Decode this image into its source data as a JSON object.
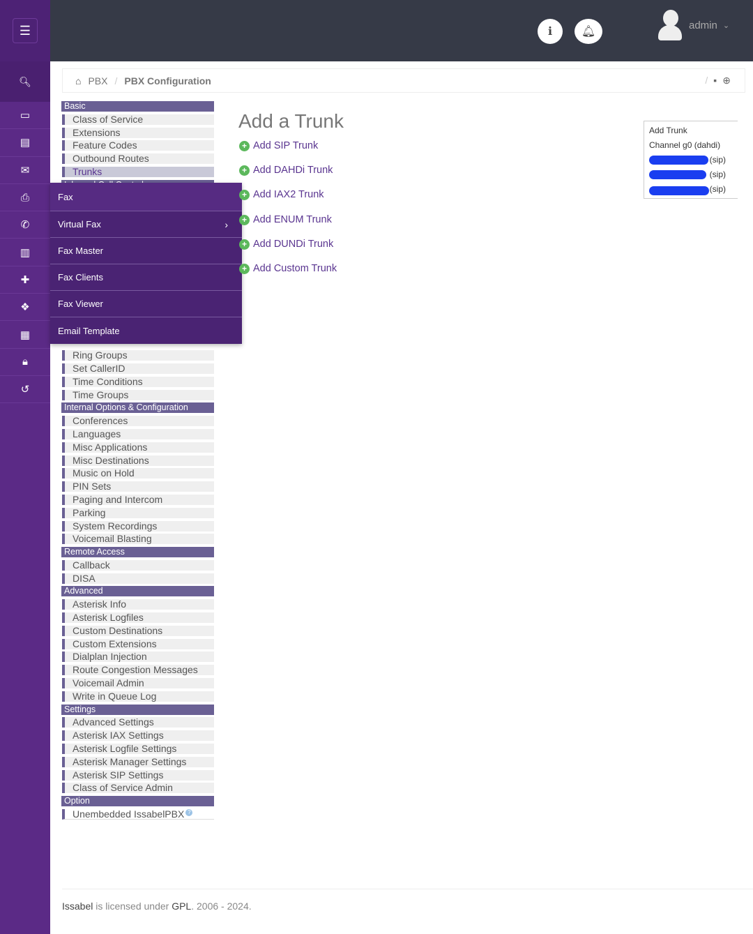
{
  "header": {
    "user": "admin"
  },
  "breadcrumb": {
    "items": [
      "PBX",
      "PBX Configuration"
    ]
  },
  "menu": {
    "basic": {
      "header": "Basic",
      "items": [
        "Class of Service",
        "Extensions",
        "Feature Codes",
        "Outbound Routes",
        "Trunks"
      ]
    },
    "inbound": {
      "header": "Inbound Call Control",
      "visible_items": [
        "Ring Groups",
        "Set CallerID",
        "Time Conditions",
        "Time Groups"
      ]
    },
    "internal": {
      "header": "Internal Options & Configuration",
      "items": [
        "Conferences",
        "Languages",
        "Misc Applications",
        "Misc Destinations",
        "Music on Hold",
        "PIN Sets",
        "Paging and Intercom",
        "Parking",
        "System Recordings",
        "Voicemail Blasting"
      ]
    },
    "remote": {
      "header": "Remote Access",
      "items": [
        "Callback",
        "DISA"
      ]
    },
    "advanced": {
      "header": "Advanced",
      "items": [
        "Asterisk Info",
        "Asterisk Logfiles",
        "Custom Destinations",
        "Custom Extensions",
        "Dialplan Injection",
        "Route Congestion Messages",
        "Voicemail Admin",
        "Write in Queue Log"
      ]
    },
    "settings": {
      "header": "Settings",
      "items": [
        "Advanced Settings",
        "Asterisk IAX Settings",
        "Asterisk Logfile Settings",
        "Asterisk Manager Settings",
        "Asterisk SIP Settings",
        "Class of Service Admin"
      ]
    },
    "option": {
      "header": "Option",
      "items": [
        "Unembedded IssabelPBX"
      ]
    }
  },
  "popup": {
    "items": [
      "Fax",
      "Virtual Fax",
      "Fax Master",
      "Fax Clients",
      "Fax Viewer",
      "Email Template"
    ]
  },
  "main": {
    "title": "Add a Trunk",
    "links": [
      "Add SIP Trunk",
      "Add DAHDi Trunk",
      "Add IAX2 Trunk",
      "Add ENUM Trunk",
      "Add DUNDi Trunk",
      "Add Custom Trunk"
    ]
  },
  "trunks": {
    "items": [
      "Add Trunk",
      "Channel g0 (dahdi)",
      "5 (sip)",
      "(sip)",
      "(sip)"
    ]
  },
  "footer": {
    "brand": "Issabel",
    "mid": " is licensed under ",
    "license": "GPL",
    "tail": ". 2006 - 2024."
  },
  "colors": {
    "rail": "#5b2a86",
    "topbar": "#363a47",
    "popup": "#4a2373",
    "menu_header": "#6a6094"
  }
}
